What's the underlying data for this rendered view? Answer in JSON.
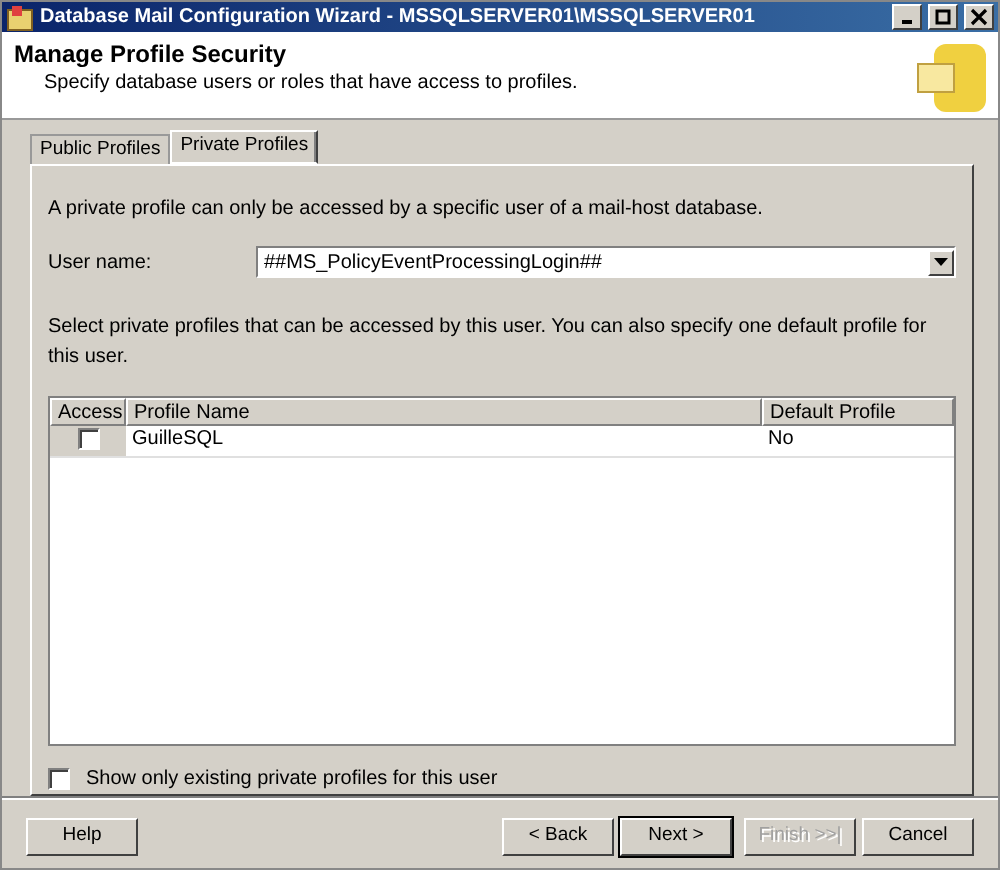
{
  "window": {
    "title": "Database Mail Configuration Wizard - MSSQLSERVER01\\MSSQLSERVER01"
  },
  "header": {
    "title": "Manage Profile Security",
    "subtitle": "Specify database users or roles that have access to profiles."
  },
  "tabs": [
    {
      "label": "Public Profiles",
      "selected": false
    },
    {
      "label": "Private Profiles",
      "selected": true
    }
  ],
  "description": "A private profile can only be accessed by a specific user of a mail-host database.",
  "user_name": {
    "label": "User name:",
    "value": "##MS_PolicyEventProcessingLogin##"
  },
  "instruction": "Select private profiles that can be accessed by this user. You can also specify one default profile for this user.",
  "table": {
    "columns": [
      "Access",
      "Profile Name",
      "Default Profile"
    ],
    "rows": [
      {
        "access": false,
        "profile_name": "GuilleSQL",
        "default_profile": "No"
      }
    ]
  },
  "show_only_existing": {
    "label": "Show only existing private profiles for this user",
    "checked": false
  },
  "buttons": [
    {
      "label": "Help",
      "kind": "left",
      "disabled": false,
      "default": false
    },
    {
      "label": "< Back",
      "kind": "right",
      "disabled": false,
      "default": false
    },
    {
      "label": "Next >",
      "kind": "right",
      "disabled": false,
      "default": true
    },
    {
      "label": "Finish >>|",
      "kind": "right",
      "disabled": true,
      "default": false
    },
    {
      "label": "Cancel",
      "kind": "right",
      "disabled": false,
      "default": false
    }
  ]
}
